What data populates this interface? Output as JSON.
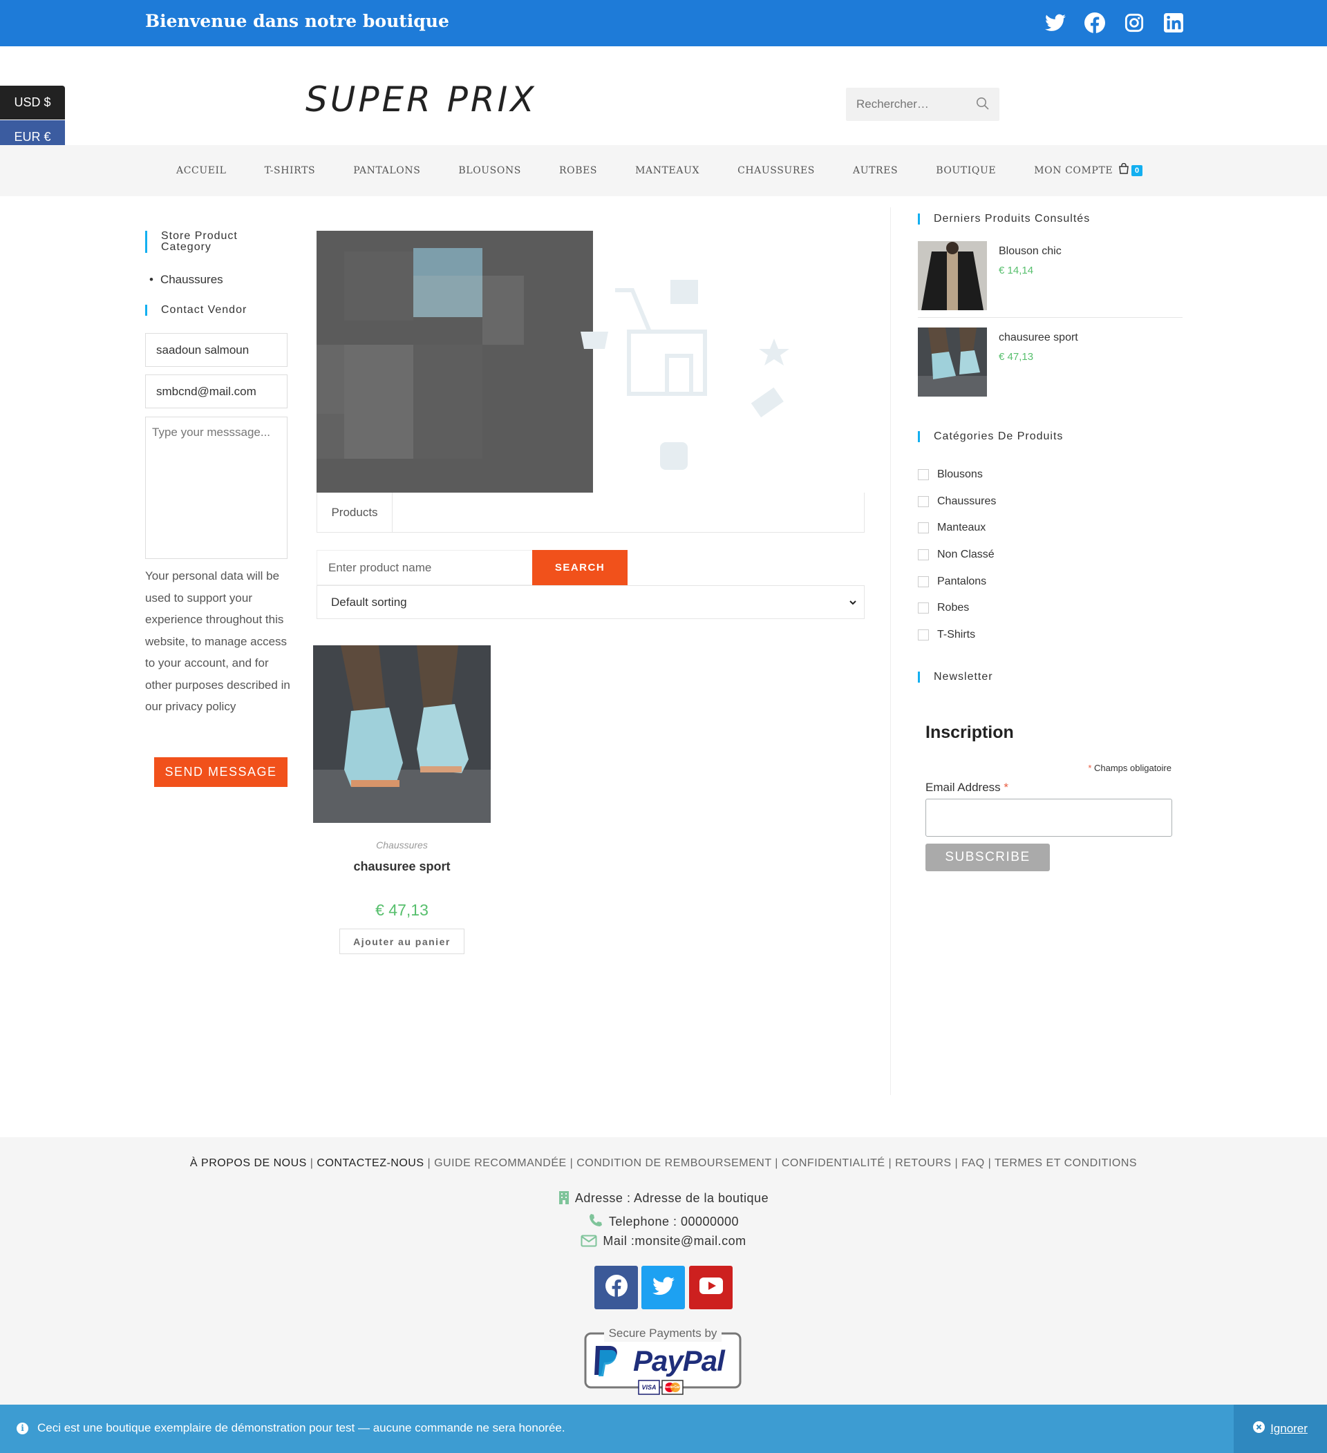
{
  "topbar": {
    "welcome": "Bienvenue dans notre boutique",
    "social_icons": [
      "twitter-icon",
      "facebook-icon",
      "instagram-icon",
      "linkedin-icon"
    ]
  },
  "currency": {
    "usd": "USD $",
    "eur": "EUR €"
  },
  "header": {
    "logo": "SUPER PRIX",
    "search_placeholder": "Rechercher…"
  },
  "nav": {
    "items": [
      "ACCUEIL",
      "T-SHIRTS",
      "PANTALONS",
      "BLOUSONS",
      "ROBES",
      "MANTEAUX",
      "CHAUSSURES",
      "AUTRES",
      "BOUTIQUE",
      "MON COMPTE"
    ],
    "cart_count": "0"
  },
  "left_sidebar": {
    "category_title": "Store Product Category",
    "categories": [
      "Chaussures"
    ],
    "contact_title": "Contact Vendor",
    "name_value": "saadoun salmoun",
    "email_value": "smbcnd@mail.com",
    "message_placeholder": "Type your messsage...",
    "privacy_text": "Your personal data will be used to support your experience throughout this website, to manage access to your account, and for other purposes described in our privacy policy",
    "send_label": "SEND MESSAGE"
  },
  "store": {
    "tab_products": "Products",
    "product_search_placeholder": "Enter product name",
    "search_label": "SEARCH",
    "sorting": "Default sorting"
  },
  "products": [
    {
      "category": "Chaussures",
      "title": "chausuree sport",
      "price": "€ 47,13",
      "add_to_cart": "Ajouter au panier"
    }
  ],
  "right_sidebar": {
    "recent_title": "Derniers Produits Consultés",
    "recent": [
      {
        "name": "Blouson chic",
        "price": "€ 14,14"
      },
      {
        "name": "chausuree sport",
        "price": "€ 47,13"
      }
    ],
    "categories_title": "Catégories De Produits",
    "categories": [
      "Blousons",
      "Chaussures",
      "Manteaux",
      "Non Classé",
      "Pantalons",
      "Robes",
      "T-Shirts"
    ],
    "newsletter_title": "Newsletter",
    "inscription": "Inscription",
    "required_note": "Champs obligatoire",
    "email_label": "Email Address",
    "subscribe_label": "SUBSCRIBE"
  },
  "footer": {
    "link_about": "À PROPOS DE NOUS",
    "link_contact": "CONTACTEZ-NOUS",
    "link_guide": "GUIDE RECOMMANDÉE",
    "link_refund": "CONDITION DE REMBOURSEMENT",
    "link_privacy": "CONFIDENTIALITÉ",
    "link_returns": "RETOURS",
    "link_faq": "FAQ",
    "link_terms": "TERMES ET CONDITIONS",
    "address": "Adresse : Adresse de la boutique",
    "phone": "Telephone : 00000000",
    "mail": "Mail :monsite@mail.com",
    "social_icons": [
      "facebook-icon",
      "twitter-icon",
      "youtube-icon"
    ],
    "paypal_top": "Secure Payments by",
    "paypal_brand": "PayPal",
    "card_labels": [
      "VISA",
      "MasterCard"
    ]
  },
  "notice": {
    "text": "Ceci est une boutique exemplaire de démonstration pour test — aucune commande ne sera honorée.",
    "dismiss": "Ignorer"
  },
  "colors": {
    "topbar": "#1e7bd8",
    "accent_orange": "#f1511b",
    "price_green": "#57bf6d",
    "accent_blue": "#13aff0",
    "notice": "#3d9cd2"
  }
}
